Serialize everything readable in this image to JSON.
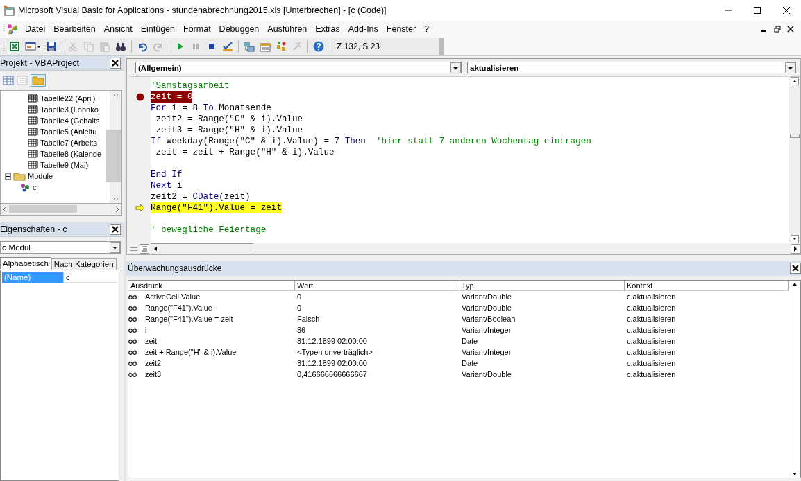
{
  "window": {
    "title": "Microsoft Visual Basic for Applications - stundenabrechnung2015.xls [Unterbrechen] - [c (Code)]"
  },
  "menu": [
    "Datei",
    "Bearbeiten",
    "Ansicht",
    "Einfügen",
    "Format",
    "Debuggen",
    "Ausführen",
    "Extras",
    "Add-Ins",
    "Fenster",
    "?"
  ],
  "toolbar": {
    "buttons": [
      {
        "kind": "excel",
        "disabled": false
      },
      {
        "kind": "form",
        "disabled": false
      },
      {
        "kind": "save",
        "disabled": false
      },
      {
        "kind": "separator"
      },
      {
        "kind": "cut",
        "disabled": true
      },
      {
        "kind": "copy",
        "disabled": true
      },
      {
        "kind": "paste",
        "disabled": true
      },
      {
        "kind": "find",
        "disabled": false
      },
      {
        "kind": "separator"
      },
      {
        "kind": "undo",
        "disabled": false
      },
      {
        "kind": "redo",
        "disabled": true
      },
      {
        "kind": "separator"
      },
      {
        "kind": "run",
        "disabled": false
      },
      {
        "kind": "pause",
        "disabled": true
      },
      {
        "kind": "stop",
        "disabled": false
      },
      {
        "kind": "design",
        "disabled": false
      },
      {
        "kind": "separator"
      },
      {
        "kind": "explorer",
        "disabled": false
      },
      {
        "kind": "properties",
        "disabled": false
      },
      {
        "kind": "objects",
        "disabled": false
      },
      {
        "kind": "toolbox",
        "disabled": true
      },
      {
        "kind": "separator"
      },
      {
        "kind": "help",
        "disabled": false
      }
    ],
    "position": "Z 132, S 23"
  },
  "project": {
    "title": "Projekt - VBAProject",
    "tree": [
      {
        "kind": "continued",
        "children": [
          {
            "label": "Tabelle22 (April)",
            "kind": "sheet"
          },
          {
            "label": "Tabelle3 (Lohnko",
            "kind": "sheet"
          },
          {
            "label": "Tabelle4 (Gehalts",
            "kind": "sheet"
          },
          {
            "label": "Tabelle5 (Anleitu",
            "kind": "sheet"
          },
          {
            "label": "Tabelle7 (Arbeits",
            "kind": "sheet"
          },
          {
            "label": "Tabelle8 (Kalende",
            "kind": "sheet"
          },
          {
            "label": "Tabelle9 (Mai)",
            "kind": "sheet"
          }
        ]
      },
      {
        "label": "Module",
        "kind": "folder",
        "expanded": true,
        "children": [
          {
            "label": "c",
            "kind": "module"
          }
        ]
      }
    ]
  },
  "properties": {
    "title": "Eigenschaften - c",
    "object_name": "c",
    "object_type": "Modul",
    "tabs": [
      {
        "label": "Alphabetisch",
        "selected": true
      },
      {
        "label": "Nach Kategorien",
        "selected": false
      }
    ],
    "rows": [
      {
        "name": "(Name)",
        "value": "c",
        "selected": true
      }
    ]
  },
  "code": {
    "object": "(Allgemein)",
    "procedure": "aktualisieren",
    "lines": [
      {
        "kind": "code",
        "segments": [
          {
            "text": "'Samstagsarbeit",
            "kind": "comment"
          }
        ]
      },
      {
        "kind": "code",
        "breakpoint": true,
        "segments": [
          {
            "text": "zeit = 0",
            "kind": "plain"
          }
        ]
      },
      {
        "kind": "code",
        "segments": [
          {
            "text": "For",
            "kind": "keyword"
          },
          {
            "text": " i = 8 ",
            "kind": "plain"
          },
          {
            "text": "To",
            "kind": "keyword"
          },
          {
            "text": " Monatsende",
            "kind": "plain"
          }
        ]
      },
      {
        "kind": "code",
        "segments": [
          {
            "text": " zeit2 = Range(\"C\" & i).Value",
            "kind": "plain"
          }
        ]
      },
      {
        "kind": "code",
        "segments": [
          {
            "text": " zeit3 = Range(\"H\" & i).Value",
            "kind": "plain"
          }
        ]
      },
      {
        "kind": "code",
        "segments": [
          {
            "text": "If",
            "kind": "keyword"
          },
          {
            "text": " Weekday(Range(\"C\" & i).Value) = 7 ",
            "kind": "plain"
          },
          {
            "text": "Then",
            "kind": "keyword"
          },
          {
            "text": "  'hier statt 7 anderen Wochentag eintragen",
            "kind": "comment"
          }
        ]
      },
      {
        "kind": "code",
        "segments": [
          {
            "text": " zeit = zeit + Range(\"H\" & i).Value",
            "kind": "plain"
          }
        ]
      },
      {
        "kind": "blank"
      },
      {
        "kind": "code",
        "segments": [
          {
            "text": "End If",
            "kind": "keyword"
          }
        ]
      },
      {
        "kind": "code",
        "segments": [
          {
            "text": "Next",
            "kind": "keyword"
          },
          {
            "text": " i",
            "kind": "plain"
          }
        ]
      },
      {
        "kind": "code",
        "segments": [
          {
            "text": "zeit2 = ",
            "kind": "plain"
          },
          {
            "text": "CDate",
            "kind": "keyword"
          },
          {
            "text": "(zeit)",
            "kind": "plain"
          }
        ]
      },
      {
        "kind": "code",
        "current": true,
        "segments": [
          {
            "text": "Range(\"F41\").Value = zeit",
            "kind": "plain"
          }
        ]
      },
      {
        "kind": "blank"
      },
      {
        "kind": "code",
        "segments": [
          {
            "text": "' bewegliche Feiertage",
            "kind": "comment"
          }
        ]
      }
    ]
  },
  "watch": {
    "title": "Überwachungsausdrücke",
    "columns": [
      "Ausdruck",
      "Wert",
      "Typ",
      "Kontext"
    ],
    "rows": [
      {
        "expression": "ActiveCell.Value",
        "value": "0",
        "type": "Variant/Double",
        "context": "c.aktualisieren"
      },
      {
        "expression": "Range(\"F41\").Value",
        "value": "0",
        "type": "Variant/Double",
        "context": "c.aktualisieren"
      },
      {
        "expression": "Range(\"F41\").Value = zeit",
        "value": "Falsch",
        "type": "Variant/Boolean",
        "context": "c.aktualisieren"
      },
      {
        "expression": "i",
        "value": "36",
        "type": "Variant/Integer",
        "context": "c.aktualisieren"
      },
      {
        "expression": "zeit",
        "value": "31.12.1899 02:00:00",
        "type": "Date",
        "context": "c.aktualisieren"
      },
      {
        "expression": "zeit + Range(\"H\" & i).Value",
        "value": "<Typen unverträglich>",
        "type": "Variant/Integer",
        "context": "c.aktualisieren"
      },
      {
        "expression": "zeit2",
        "value": "31.12.1899 02:00:00",
        "type": "Date",
        "context": "c.aktualisieren"
      },
      {
        "expression": "zeit3",
        "value": "0,416666666666667",
        "type": "Variant/Double",
        "context": "c.aktualisieren"
      }
    ]
  }
}
